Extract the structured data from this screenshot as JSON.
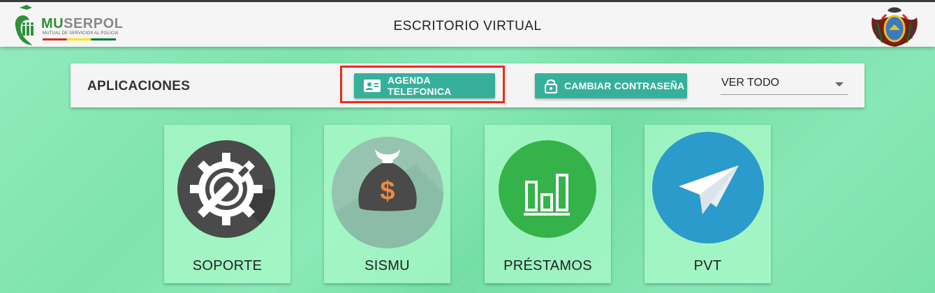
{
  "header": {
    "logo_text_main": "MU",
    "logo_text_rest": "SERPOL",
    "logo_subtitle": "MUTUAL DE SERVICIOS AL POLICIA",
    "title": "ESCRITORIO VIRTUAL"
  },
  "toolbar": {
    "title": "APLICACIONES",
    "agenda_label": "AGENDA TELEFONICA",
    "password_label": "CAMBIAR CONTRASEÑA",
    "filter_value": "VER TODO"
  },
  "apps": [
    {
      "label": "SOPORTE",
      "icon": "gear-wrench-icon",
      "color": "#4a4a4a"
    },
    {
      "label": "SISMU",
      "icon": "money-bag-icon",
      "color": "#96c4b0"
    },
    {
      "label": "PRÉSTAMOS",
      "icon": "bar-chart-icon",
      "color": "#36b24a"
    },
    {
      "label": "PVT",
      "icon": "paper-plane-icon",
      "color": "#2b9bcb"
    }
  ],
  "colors": {
    "accent": "#36b09a",
    "highlight": "#f02a17",
    "background": "#84e8b4"
  }
}
